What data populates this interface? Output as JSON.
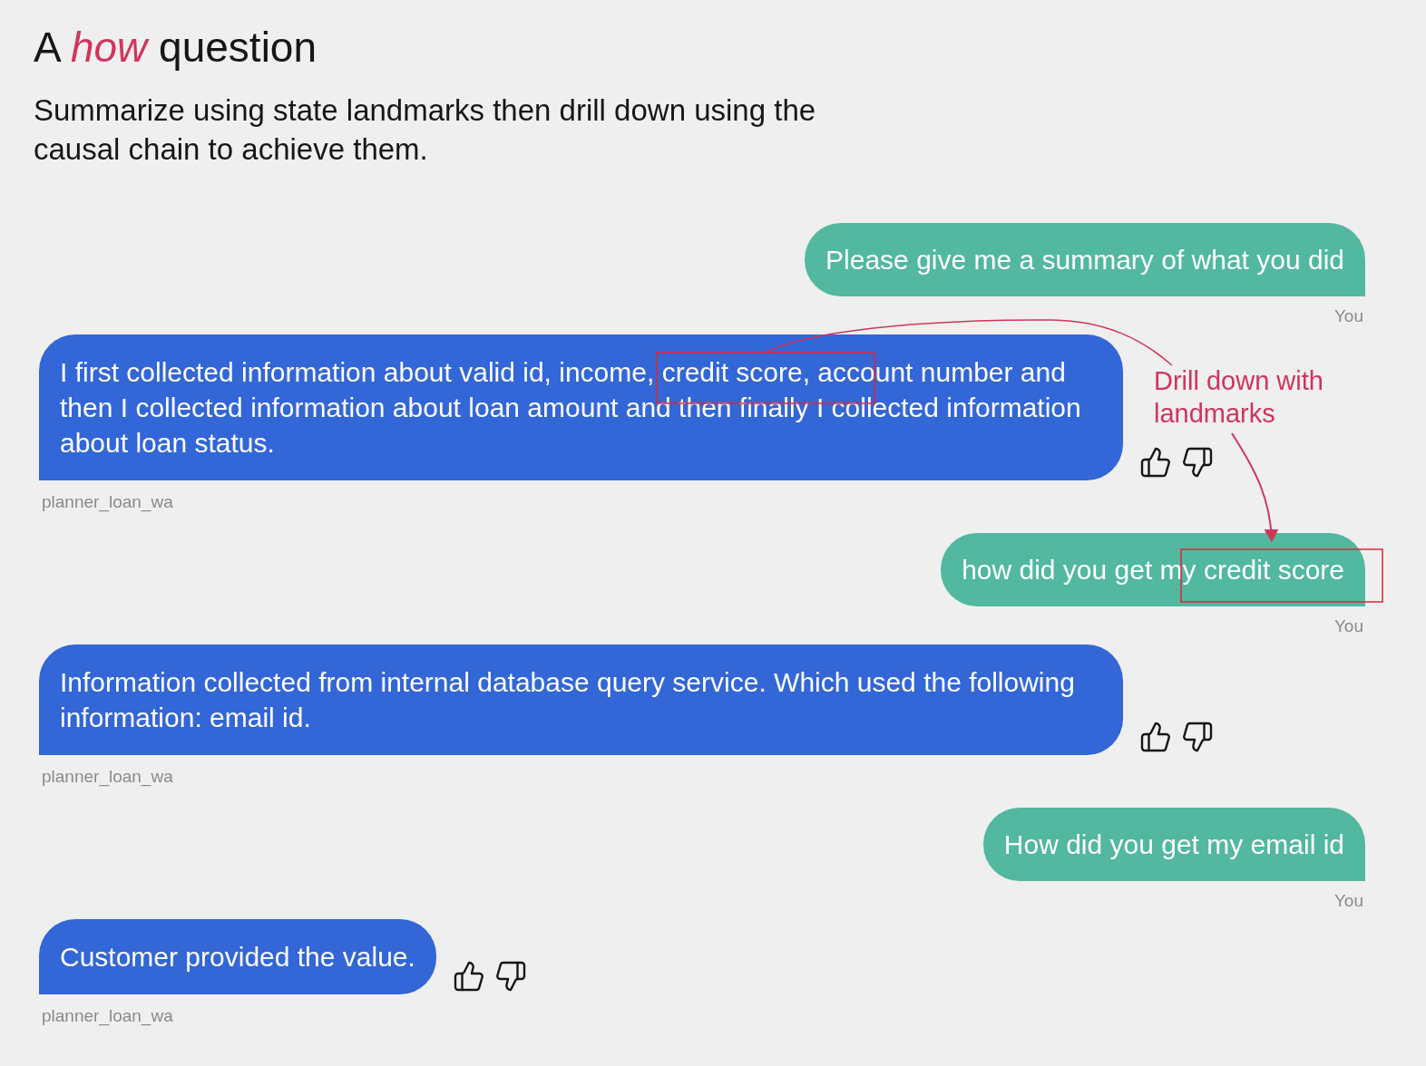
{
  "title": "A *how* question",
  "subtitle": "Summarize using state landmarks then drill down using the causal chain to achieve them.",
  "messages": [
    {
      "kind": "user",
      "text": "Please give me a summary of what you did",
      "sender": "You"
    },
    {
      "kind": "bot",
      "text": "I first collected information about valid id, income, credit score, account number and then I collected information about loan amount and then finally I collected information about loan status.",
      "sender": "planner_loan_wa"
    },
    {
      "kind": "user",
      "text": "how did you get my credit score",
      "sender": "You"
    },
    {
      "kind": "bot",
      "text": "Information collected from internal database query service. Which used the following information: email id.",
      "sender": "planner_loan_wa"
    },
    {
      "kind": "user",
      "text": "How did you get my email id",
      "sender": "You"
    },
    {
      "kind": "bot",
      "text": "Customer provided the value.",
      "sender": "planner_loan_wa"
    }
  ],
  "annotation": "Drill down with landmarks"
}
